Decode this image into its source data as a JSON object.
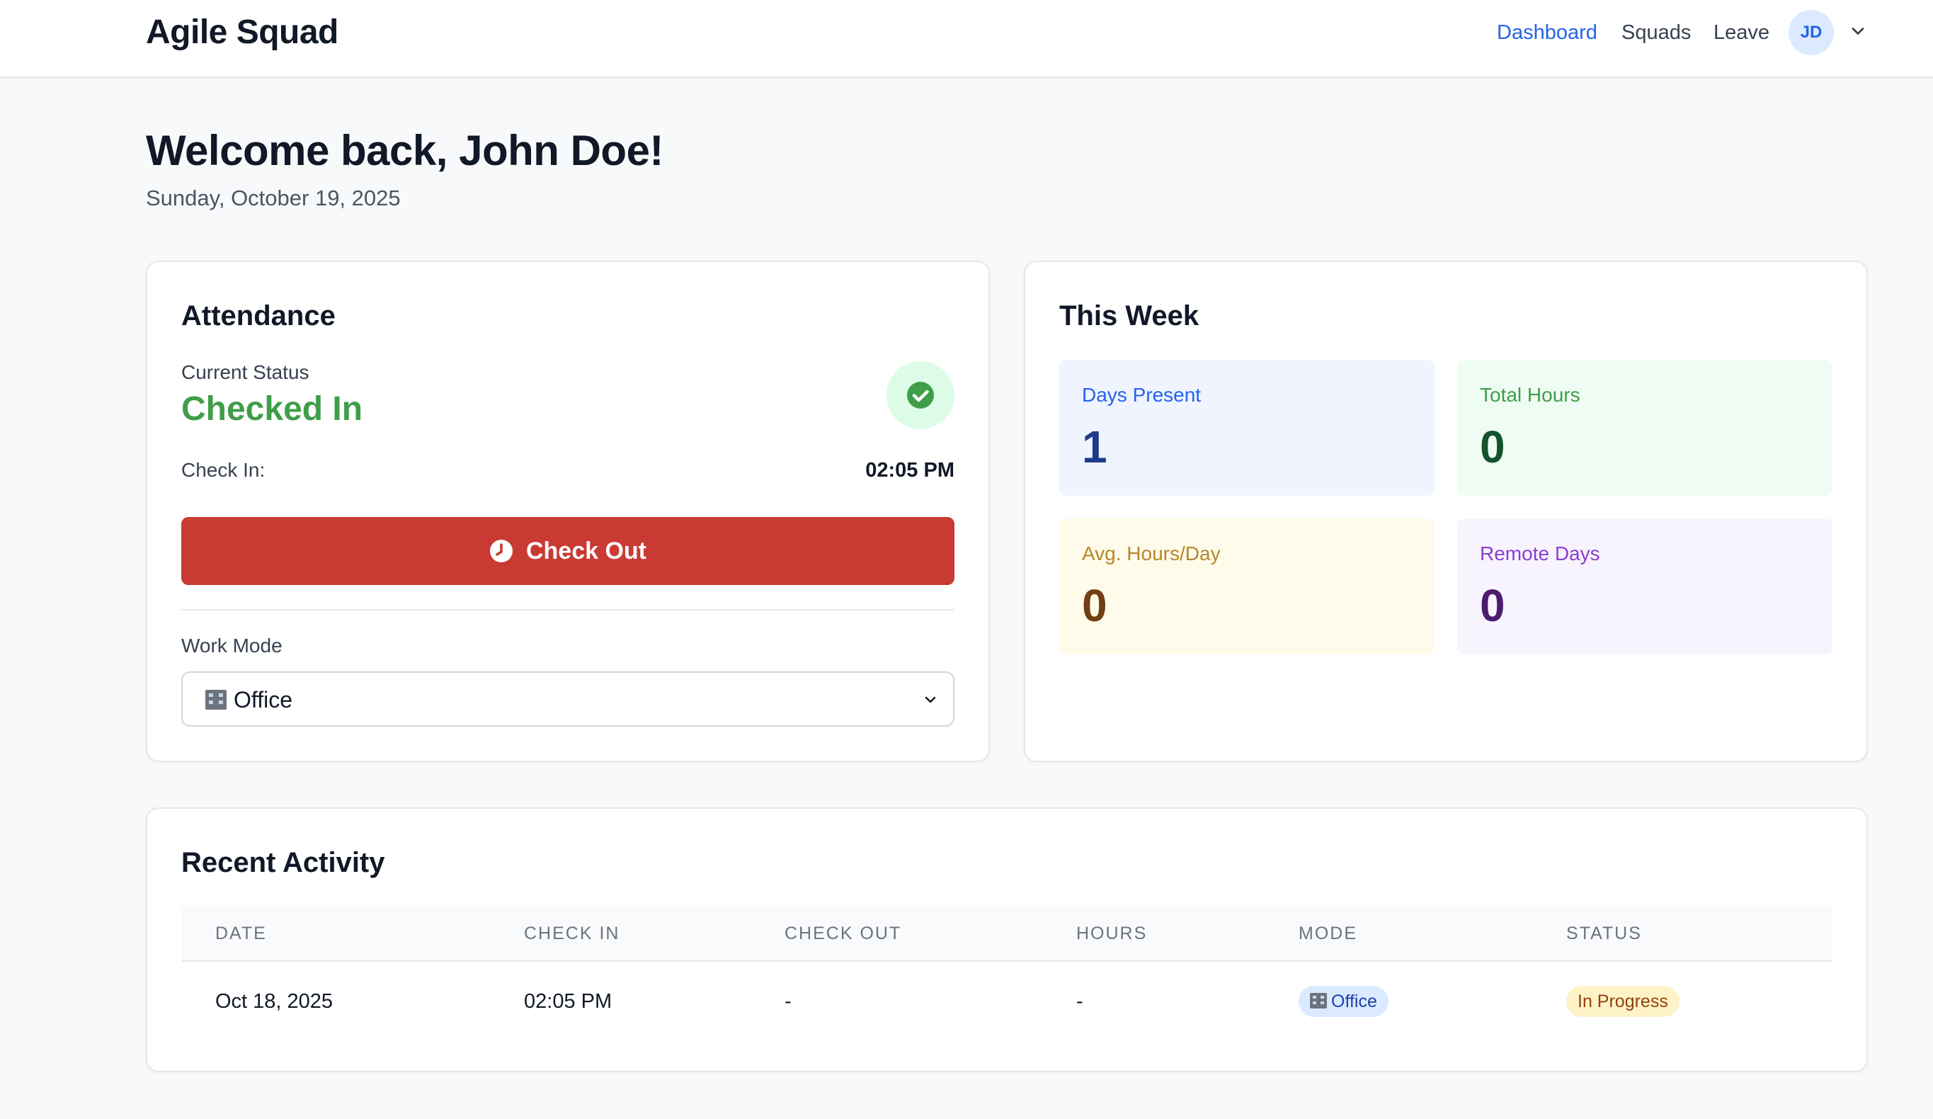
{
  "header": {
    "brand": "Agile Squad",
    "nav": [
      {
        "label": "Dashboard",
        "active": true
      },
      {
        "label": "Squads",
        "active": false
      },
      {
        "label": "Leave",
        "active": false
      }
    ],
    "avatar_initials": "JD"
  },
  "welcome": {
    "title": "Welcome back, John Doe!",
    "date": "Sunday, October 19, 2025"
  },
  "attendance": {
    "title": "Attendance",
    "current_status_label": "Current Status",
    "current_status": "Checked In",
    "check_in_label": "Check In:",
    "check_in_time": "02:05 PM",
    "check_out_button": "Check Out",
    "work_mode_label": "Work Mode",
    "work_mode_value": "Office",
    "colors": {
      "status": "#3f9e49",
      "check_out": "#c93a32"
    }
  },
  "this_week": {
    "title": "This Week",
    "stats": [
      {
        "label": "Days Present",
        "value": "1",
        "bg": "#eff4fe",
        "label_color": "#2563eb",
        "value_color": "#1e3a8a"
      },
      {
        "label": "Total Hours",
        "value": "0",
        "bg": "#effcf3",
        "label_color": "#3f9e49",
        "value_color": "#14532d"
      },
      {
        "label": "Avg. Hours/Day",
        "value": "0",
        "bg": "#fefbea",
        "label_color": "#b7862a",
        "value_color": "#713f12"
      },
      {
        "label": "Remote Days",
        "value": "0",
        "bg": "#f8f4fe",
        "label_color": "#8b3fd1",
        "value_color": "#4c1d6e"
      }
    ]
  },
  "recent": {
    "title": "Recent Activity",
    "columns": [
      "DATE",
      "CHECK IN",
      "CHECK OUT",
      "HOURS",
      "MODE",
      "STATUS"
    ],
    "rows": [
      {
        "date": "Oct 18, 2025",
        "check_in": "02:05 PM",
        "check_out": "-",
        "hours": "-",
        "mode": "Office",
        "status": "In Progress"
      }
    ]
  }
}
